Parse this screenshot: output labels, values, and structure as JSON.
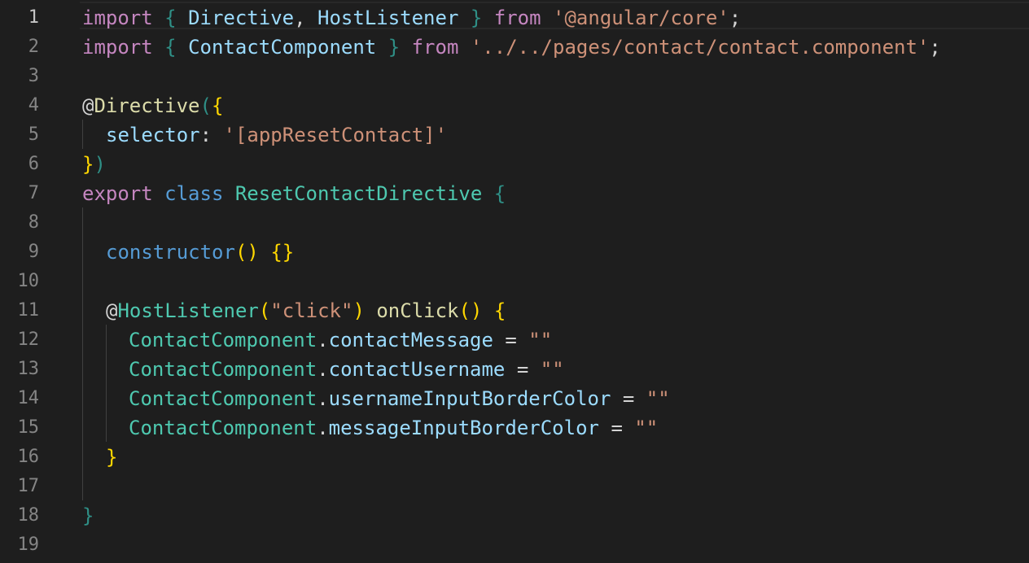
{
  "editor": {
    "colors": {
      "background": "#1e1e1e",
      "line_number": "#858585",
      "keyword_control": "#c586c0",
      "keyword_storage": "#569cd6",
      "type": "#4ec9b0",
      "variable": "#9cdcfe",
      "string": "#ce9178",
      "function": "#dcdcaa",
      "bracket_gold": "#ffd700"
    },
    "line_numbers": [
      "1",
      "2",
      "3",
      "4",
      "5",
      "6",
      "7",
      "8",
      "9",
      "10",
      "11",
      "12",
      "13",
      "14",
      "15",
      "16",
      "17",
      "18",
      "19"
    ],
    "lines": {
      "l1": {
        "import": "import",
        "open_brace": "{",
        "directive": "Directive",
        "comma": ",",
        "hostlistener": "HostListener",
        "close_brace": "}",
        "from": "from",
        "module": "'@angular/core'",
        "semi": ";"
      },
      "l2": {
        "import": "import",
        "open_brace": "{",
        "contactcomponent": "ContactComponent",
        "close_brace": "}",
        "from": "from",
        "module": "'../../pages/contact/contact.component'",
        "semi": ";"
      },
      "l4": {
        "at": "@",
        "name": "Directive",
        "open_paren": "(",
        "open_brace": "{"
      },
      "l5": {
        "key": "selector",
        "colon": ":",
        "value": "'[appResetContact]'"
      },
      "l6": {
        "close_brace": "}",
        "close_paren": ")"
      },
      "l7": {
        "export": "export",
        "class": "class",
        "name": "ResetContactDirective",
        "open_brace": "{"
      },
      "l9": {
        "name": "constructor",
        "parens": "()",
        "body": "{}"
      },
      "l11": {
        "at": "@",
        "name": "HostListener",
        "open_paren": "(",
        "arg": "\"click\"",
        "close_paren": ")",
        "method": "onClick",
        "parens": "()",
        "open_brace": "{"
      },
      "l12": {
        "obj": "ContactComponent",
        "dot": ".",
        "prop": "contactMessage",
        "eq": "=",
        "val": "\"\""
      },
      "l13": {
        "obj": "ContactComponent",
        "dot": ".",
        "prop": "contactUsername",
        "eq": "=",
        "val": "\"\""
      },
      "l14": {
        "obj": "ContactComponent",
        "dot": ".",
        "prop": "usernameInputBorderColor",
        "eq": "=",
        "val": "\"\""
      },
      "l15": {
        "obj": "ContactComponent",
        "dot": ".",
        "prop": "messageInputBorderColor",
        "eq": "=",
        "val": "\"\""
      },
      "l16": {
        "close_brace": "}"
      },
      "l18": {
        "close_brace": "}"
      }
    }
  }
}
